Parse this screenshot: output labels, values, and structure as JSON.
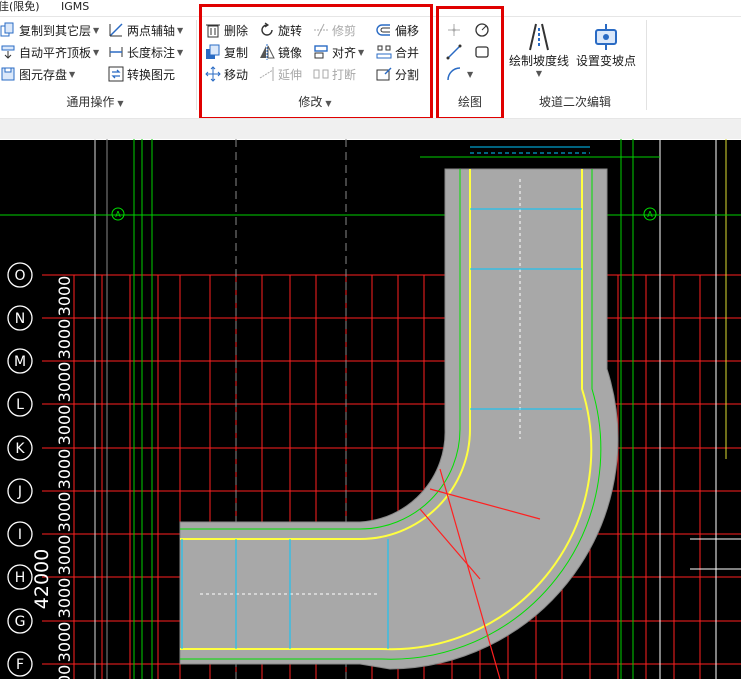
{
  "tabs": [
    {
      "label": "佳(限免)"
    },
    {
      "label": "IGMS"
    }
  ],
  "groups": {
    "common": {
      "label": "通用操作",
      "items": [
        {
          "label": "复制到其它层",
          "icon": "copy-to-layer-icon"
        },
        {
          "label": "两点辅轴",
          "icon": "two-point-axis-icon"
        },
        {
          "label": "自动平齐顶板",
          "icon": "auto-align-slab-icon"
        },
        {
          "label": "长度标注",
          "icon": "length-dimension-icon"
        },
        {
          "label": "图元存盘",
          "icon": "save-element-icon"
        },
        {
          "label": "转换图元",
          "icon": "convert-element-icon"
        }
      ]
    },
    "modify": {
      "label": "修改",
      "items": [
        {
          "label": "删除",
          "icon": "delete-icon"
        },
        {
          "label": "旋转",
          "icon": "rotate-icon"
        },
        {
          "label": "修剪",
          "icon": "trim-icon"
        },
        {
          "label": "偏移",
          "icon": "offset-icon"
        },
        {
          "label": "复制",
          "icon": "copy-icon"
        },
        {
          "label": "镜像",
          "icon": "mirror-icon"
        },
        {
          "label": "对齐",
          "icon": "align-icon"
        },
        {
          "label": "合并",
          "icon": "merge-icon"
        },
        {
          "label": "移动",
          "icon": "move-icon"
        },
        {
          "label": "延伸",
          "icon": "extend-icon"
        },
        {
          "label": "打断",
          "icon": "break-icon"
        },
        {
          "label": "分割",
          "icon": "split-icon"
        }
      ]
    },
    "draw": {
      "label": "绘图",
      "items": [
        {
          "icon": "point-icon"
        },
        {
          "icon": "circle-icon"
        },
        {
          "icon": "line-icon"
        },
        {
          "icon": "rectangle-icon"
        },
        {
          "icon": "arc-icon"
        }
      ]
    },
    "ramp": {
      "label": "坡道二次编辑",
      "items": [
        {
          "label": "绘制坡度线",
          "icon": "slope-line-icon"
        },
        {
          "label": "设置变坡点",
          "icon": "grade-point-icon"
        }
      ]
    }
  },
  "axis_labels": [
    "O",
    "N",
    "M",
    "L",
    "K",
    "J",
    "I",
    "H",
    "G",
    "F"
  ],
  "axis_spacing_labels": [
    "3000",
    "3000",
    "3000",
    "3000",
    "3000",
    "3000",
    "3000",
    "3000",
    "3000",
    "3000"
  ],
  "total_dimension": "42000",
  "top_axis_label": "A",
  "colors": {
    "highlight_box": "#e00000",
    "canvas_bg": "#000000",
    "grid_red": "#ff2020",
    "green": "#00e000",
    "ramp_fill": "#a8a8a8",
    "yellow": "#ffff40",
    "cyan": "#00c8ff"
  }
}
